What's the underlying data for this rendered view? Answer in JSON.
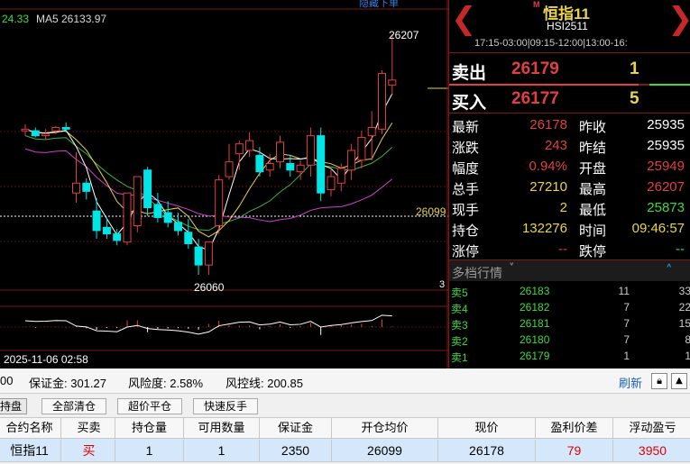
{
  "chart": {
    "top_link": "隐藏下单",
    "ma_value_partial": "24.33",
    "ma5_label": "MA5 26133.97",
    "high_label": "26207",
    "low_label": "26060",
    "price_line_label": "26099",
    "vol_axis_label": "3",
    "date_label": "2025-11-06 02:58",
    "candles": [
      {
        "o": 26148,
        "h": 26152,
        "l": 26145,
        "c": 26149
      },
      {
        "o": 26148,
        "h": 26150,
        "l": 26144,
        "c": 26145
      },
      {
        "o": 26145,
        "h": 26149,
        "l": 26143,
        "c": 26146
      },
      {
        "o": 26148,
        "h": 26151,
        "l": 26146,
        "c": 26150
      },
      {
        "o": 26150,
        "h": 26153,
        "l": 26147,
        "c": 26149
      },
      {
        "o": 26110,
        "h": 26135,
        "l": 26104,
        "c": 26116
      },
      {
        "o": 26116,
        "h": 26119,
        "l": 26106,
        "c": 26111
      },
      {
        "o": 26099,
        "h": 26107,
        "l": 26082,
        "c": 26087
      },
      {
        "o": 26089,
        "h": 26095,
        "l": 26082,
        "c": 26085
      },
      {
        "o": 26085,
        "h": 26088,
        "l": 26078,
        "c": 26081
      },
      {
        "o": 26080,
        "h": 26110,
        "l": 26078,
        "c": 26110
      },
      {
        "o": 26090,
        "h": 26120,
        "l": 26086,
        "c": 26120
      },
      {
        "o": 26124,
        "h": 26126,
        "l": 26096,
        "c": 26101
      },
      {
        "o": 26103,
        "h": 26110,
        "l": 26092,
        "c": 26095
      },
      {
        "o": 26098,
        "h": 26105,
        "l": 26089,
        "c": 26092
      },
      {
        "o": 26092,
        "h": 26098,
        "l": 26084,
        "c": 26087
      },
      {
        "o": 26086,
        "h": 26094,
        "l": 26076,
        "c": 26079
      },
      {
        "o": 26077,
        "h": 26082,
        "l": 26060,
        "c": 26066
      },
      {
        "o": 26066,
        "h": 26080,
        "l": 26060,
        "c": 26080
      },
      {
        "o": 26090,
        "h": 26121,
        "l": 26085,
        "c": 26118
      },
      {
        "o": 26120,
        "h": 26140,
        "l": 26118,
        "c": 26129
      },
      {
        "o": 26134,
        "h": 26142,
        "l": 26124,
        "c": 26140
      },
      {
        "o": 26136,
        "h": 26147,
        "l": 26132,
        "c": 26142
      },
      {
        "o": 26133,
        "h": 26138,
        "l": 26120,
        "c": 26123
      },
      {
        "o": 26124,
        "h": 26134,
        "l": 26120,
        "c": 26128
      },
      {
        "o": 26129,
        "h": 26145,
        "l": 26125,
        "c": 26141
      },
      {
        "o": 26128,
        "h": 26133,
        "l": 26120,
        "c": 26124
      },
      {
        "o": 26123,
        "h": 26130,
        "l": 26118,
        "c": 26127
      },
      {
        "o": 26127,
        "h": 26150,
        "l": 26120,
        "c": 26145
      },
      {
        "o": 26145,
        "h": 26150,
        "l": 26105,
        "c": 26110
      },
      {
        "o": 26112,
        "h": 26125,
        "l": 26108,
        "c": 26120
      },
      {
        "o": 26116,
        "h": 26128,
        "l": 26111,
        "c": 26125
      },
      {
        "o": 26124,
        "h": 26140,
        "l": 26118,
        "c": 26136
      },
      {
        "o": 26130,
        "h": 26148,
        "l": 26125,
        "c": 26144
      },
      {
        "o": 26145,
        "h": 26160,
        "l": 26130,
        "c": 26150
      },
      {
        "o": 26149,
        "h": 26185,
        "l": 26146,
        "c": 26183
      },
      {
        "o": 26176,
        "h": 26207,
        "l": 26170,
        "c": 26179
      }
    ]
  },
  "instrument": {
    "name": "恒指11",
    "code": "HSI2511",
    "m_badge": "M",
    "sessions": "17:15-03:00|09:15-12:00|13:00-16:"
  },
  "ask": {
    "label": "卖出",
    "price": "26179",
    "qty": "1"
  },
  "bid": {
    "label": "买入",
    "price": "26177",
    "qty": "5"
  },
  "quote": [
    {
      "l1": "最新",
      "v1": "26178",
      "c1": "#e04040",
      "l2": "昨收",
      "v2": "25935",
      "c2": "#ffffff"
    },
    {
      "l1": "涨跌",
      "v1": "243",
      "c1": "#e04040",
      "l2": "昨结",
      "v2": "25935",
      "c2": "#ffffff"
    },
    {
      "l1": "幅度",
      "v1": "0.94%",
      "c1": "#e04040",
      "l2": "开盘",
      "v2": "25949",
      "c2": "#e04040"
    },
    {
      "l1": "总手",
      "v1": "27210",
      "c1": "#e8d44d",
      "l2": "最高",
      "v2": "26207",
      "c2": "#e04040"
    },
    {
      "l1": "现手",
      "v1": "2",
      "c1": "#e8d44d",
      "l2": "最低",
      "v2": "25873",
      "c2": "#3ddc3d"
    },
    {
      "l1": "持仓",
      "v1": "132276",
      "c1": "#e8d44d",
      "l2": "时间",
      "v2": "09:46:57",
      "c2": "#e8d44d"
    },
    {
      "l1": "涨停",
      "v1": "--",
      "c1": "#e04040",
      "l2": "跌停",
      "v2": "--",
      "c2": "#3ddc3d"
    }
  ],
  "depth_header": "多档行情",
  "orderbook": [
    {
      "label": "卖5",
      "price": "26183",
      "qty": "11",
      "total": "33"
    },
    {
      "label": "卖4",
      "price": "26182",
      "qty": "7",
      "total": "22"
    },
    {
      "label": "卖3",
      "price": "26181",
      "qty": "7",
      "total": "15"
    },
    {
      "label": "卖2",
      "price": "26180",
      "qty": "7",
      "total": "8"
    },
    {
      "label": "卖1",
      "price": "26179",
      "qty": "1",
      "total": "1"
    }
  ],
  "account": {
    "value_partial": "00",
    "margin": "保证金: 301.27",
    "risk": "风险度: 2.58%",
    "risk_line": "风控线: 200.85",
    "refresh": "刷新"
  },
  "buttons": {
    "tab": "持盘",
    "close_all": "全部清仓",
    "super_close": "超价平仓",
    "reverse": "快速反手"
  },
  "table": {
    "headers": [
      "合约名称",
      "买卖",
      "持仓量",
      "可用数量",
      "保证金",
      "开仓均价",
      "现价",
      "盈利价差",
      "浮动盈亏"
    ],
    "row": [
      "恒指11",
      "买",
      "1",
      "1",
      "2350",
      "26099",
      "26178",
      "79",
      "3950"
    ]
  },
  "colors": {
    "up": "#e04040",
    "down": "#00e5e5",
    "ma5": "#ffffff",
    "ma10": "#e8d44d",
    "ma20": "#3bb34a",
    "ma60": "#d040d0"
  }
}
